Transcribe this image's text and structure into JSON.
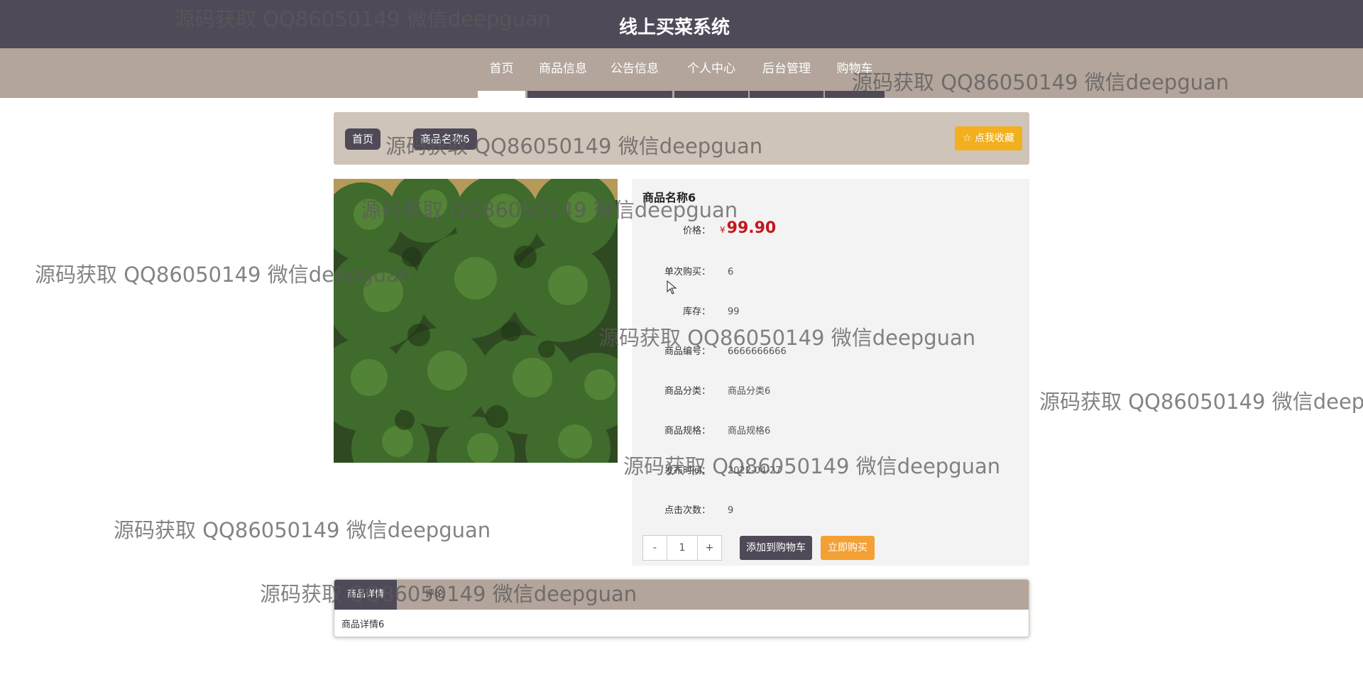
{
  "header": {
    "title": "线上买菜系统"
  },
  "nav": {
    "items": [
      {
        "label": "首页"
      },
      {
        "label": "商品信息"
      },
      {
        "label": "公告信息"
      },
      {
        "label": "个人中心"
      },
      {
        "label": "后台管理"
      },
      {
        "label": "购物车"
      }
    ]
  },
  "breadcrumb": {
    "home": "首页",
    "current": "商品名称6"
  },
  "favorite": {
    "label": "☆ 点我收藏",
    "icon": "star-outline-icon"
  },
  "product": {
    "name": "商品名称6",
    "price_label": "价格：",
    "price_symbol": "¥",
    "price": "99.90",
    "fields": [
      {
        "label": "单次购买：",
        "value": "6"
      },
      {
        "label": "库存：",
        "value": "99"
      },
      {
        "label": "商品编号：",
        "value": "6666666666"
      },
      {
        "label": "商品分类：",
        "value": "商品分类6"
      },
      {
        "label": "商品规格：",
        "value": "商品规格6"
      },
      {
        "label": "发布时间：",
        "value": "2022-04-27"
      },
      {
        "label": "点击次数：",
        "value": "9"
      }
    ],
    "image": "broccoli"
  },
  "quantity": {
    "minus": "-",
    "value": "1",
    "plus": "+"
  },
  "actions": {
    "add_to_cart": "添加到购物车",
    "buy_now": "立即购买"
  },
  "tabs": {
    "items": [
      {
        "label": "商品详情"
      },
      {
        "label": "评论"
      }
    ],
    "content": "商品详情6"
  },
  "watermark": "源码获取 QQ86050149 微信deepguan",
  "colors": {
    "header": "#4f4958",
    "nav": "#b3a59b",
    "breadcrumb_bg": "#cfc4b9",
    "price": "#c4161c",
    "favorite": "#f2b01e",
    "buy": "#f3a034"
  }
}
